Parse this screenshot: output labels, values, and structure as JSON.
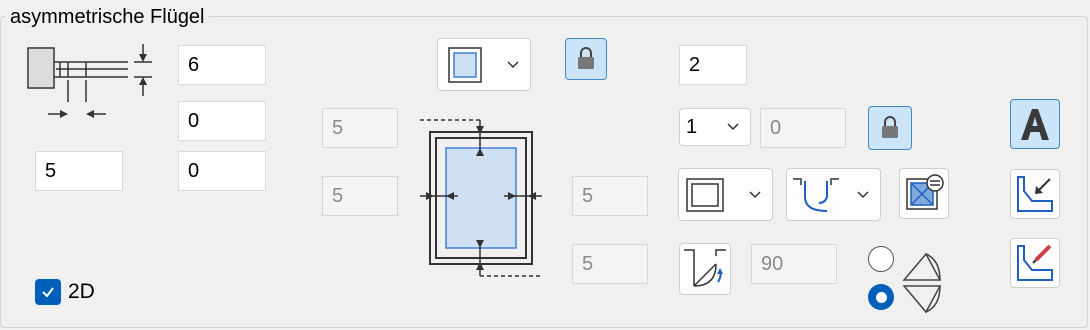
{
  "group": {
    "title": "asymmetrische Flügel"
  },
  "left_fields": {
    "field_a": "6",
    "field_b": "0",
    "field_c": "5",
    "field_d": "0"
  },
  "center_fields": {
    "top_left": "5",
    "mid_left": "5",
    "mid_right": "5",
    "bottom_right": "5"
  },
  "right_fields": {
    "count": "2",
    "combo_value": "1",
    "combo_side": "0",
    "angle": "90"
  },
  "checkbox_2d": {
    "label": "2D",
    "checked": true
  },
  "radio": {
    "selected_index": 1
  },
  "icons": {
    "frame_profile": "frame-profile-diagram-icon",
    "sash_diagram": "sash-inset-diagram-icon",
    "lock": "lock-icon",
    "text_a": "text-a-icon"
  },
  "colors": {
    "accent": "#005fb8",
    "selected_bg": "#cce4f7",
    "glass_fill": "#cfe0f5",
    "glass_stroke": "#3f7fd0"
  }
}
